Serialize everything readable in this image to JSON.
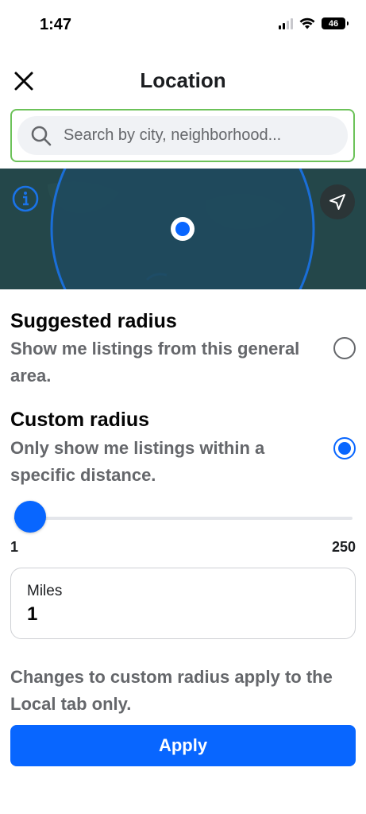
{
  "status_bar": {
    "time": "1:47",
    "battery": "46",
    "icons": [
      "signal-icon",
      "wifi-icon",
      "battery-icon"
    ]
  },
  "header": {
    "title": "Location",
    "close_icon": "close-icon"
  },
  "search": {
    "placeholder": "Search by city, neighborhood...",
    "value": ""
  },
  "map": {
    "icons": [
      "info-icon",
      "navigation-arrow-icon",
      "location-pin-icon"
    ]
  },
  "options": {
    "suggested": {
      "title": "Suggested radius",
      "description": "Show me listings from this general area.",
      "selected": false
    },
    "custom": {
      "title": "Custom radius",
      "description": "Only show me listings within a specific distance.",
      "selected": true
    }
  },
  "slider": {
    "min_label": "1",
    "max_label": "250",
    "min": 1,
    "max": 250,
    "value": 1
  },
  "miles": {
    "label": "Miles",
    "value": "1"
  },
  "note": "Changes to custom radius apply to the Local tab only.",
  "apply_label": "Apply",
  "colors": {
    "accent": "#0866ff",
    "map": "#24474a",
    "search_focus_border": "#6cc259"
  }
}
